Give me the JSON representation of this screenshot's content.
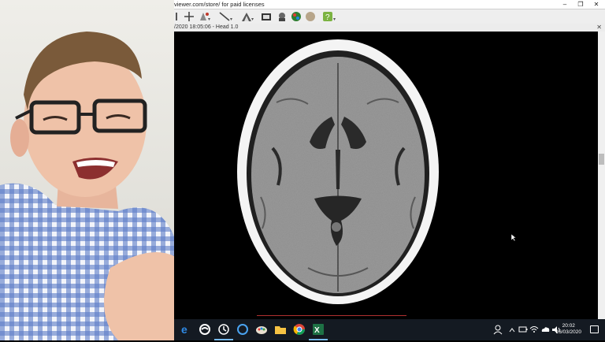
{
  "window": {
    "title": "viewer.com/store/ for paid licenses",
    "minimize_glyph": "–",
    "maximize_glyph": "❐",
    "close_glyph": "✕"
  },
  "infobar": {
    "text": "/2020 18:05:06 - Head 1.0",
    "close_glyph": "✕"
  },
  "toolbar": {
    "icons": [
      "select-icon",
      "crosshair-icon",
      "window-level-icon",
      "measure-line-icon",
      "3d-render-icon",
      "export-icon",
      "anonymize-icon",
      "color-lut-icon",
      "sphere-icon",
      "help-icon"
    ]
  },
  "taskbar": {
    "apps": [
      "edge-icon",
      "app-swirl-icon",
      "clock-app-icon",
      "cortana-icon",
      "paint-icon",
      "file-explorer-icon",
      "chrome-icon",
      "excel-icon"
    ],
    "tray_icons": [
      "people-icon",
      "chevron-up-icon",
      "battery-icon",
      "wifi-icon",
      "onedrive-icon",
      "volume-icon"
    ],
    "time": "20:02",
    "date": "16/03/2020"
  },
  "colors": {
    "accent": "#76b9ed",
    "taskbar_bg": "#141a22"
  }
}
